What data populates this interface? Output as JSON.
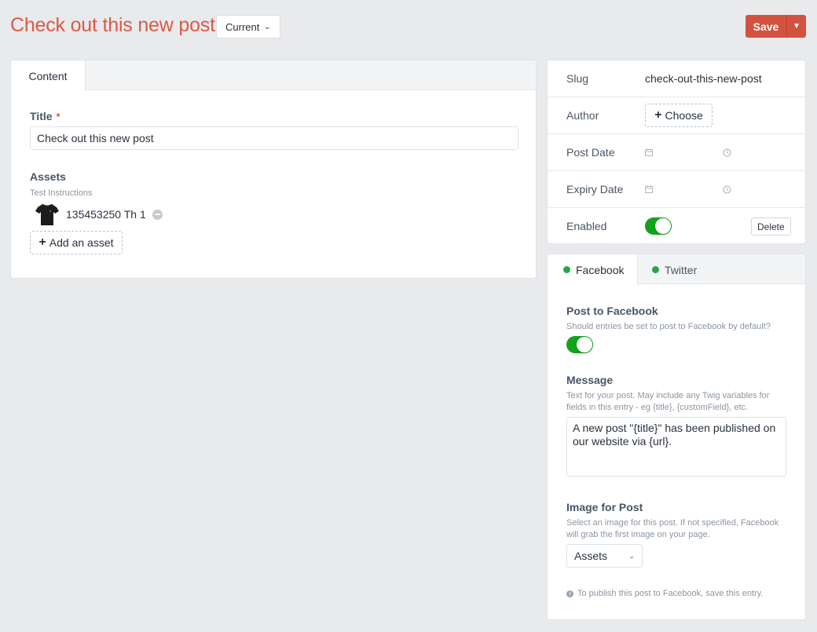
{
  "header": {
    "title": "Check out this new post",
    "revision_label": "Current",
    "save_label": "Save"
  },
  "main": {
    "tabs": [
      {
        "label": "Content"
      }
    ],
    "title_field": {
      "label": "Title",
      "required_marker": "*",
      "value": "Check out this new post"
    },
    "assets_field": {
      "label": "Assets",
      "instructions": "Test Instructions",
      "items": [
        {
          "name": "135453250 Th 1",
          "thumbnail": "black-tshirt-thumbnail"
        }
      ],
      "add_label": "Add an asset"
    }
  },
  "meta": {
    "slug": {
      "label": "Slug",
      "value": "check-out-this-new-post"
    },
    "author": {
      "label": "Author",
      "choose_label": "Choose"
    },
    "post_date": {
      "label": "Post Date",
      "date_icon": "calendar-icon",
      "time_icon": "clock-icon"
    },
    "expiry_date": {
      "label": "Expiry Date",
      "date_icon": "calendar-icon",
      "time_icon": "clock-icon"
    },
    "enabled": {
      "label": "Enabled",
      "on": true,
      "delete_label": "Delete"
    }
  },
  "social": {
    "tabs": [
      {
        "label": "Facebook",
        "status_color": "#27a54a"
      },
      {
        "label": "Twitter",
        "status_color": "#27a54a"
      }
    ],
    "post_to": {
      "label": "Post to Facebook",
      "help": "Should entries be set to post to Facebook by default?",
      "on": true
    },
    "message": {
      "label": "Message",
      "help": "Text for your post. May include any Twig variables for fields in this entry - eg {title}, {customField}, etc.",
      "value": "A new post \"{title}\" has been published on our website via {url}."
    },
    "image": {
      "label": "Image for Post",
      "help": "Select an image for this post. If not specified, Facebook will grab the first image on your page.",
      "selected": "Assets"
    },
    "note": "To publish this post to Facebook, save this entry."
  },
  "colors": {
    "accent": "#da5a47",
    "save": "#d3523f",
    "toggle_on": "#12a31c"
  }
}
